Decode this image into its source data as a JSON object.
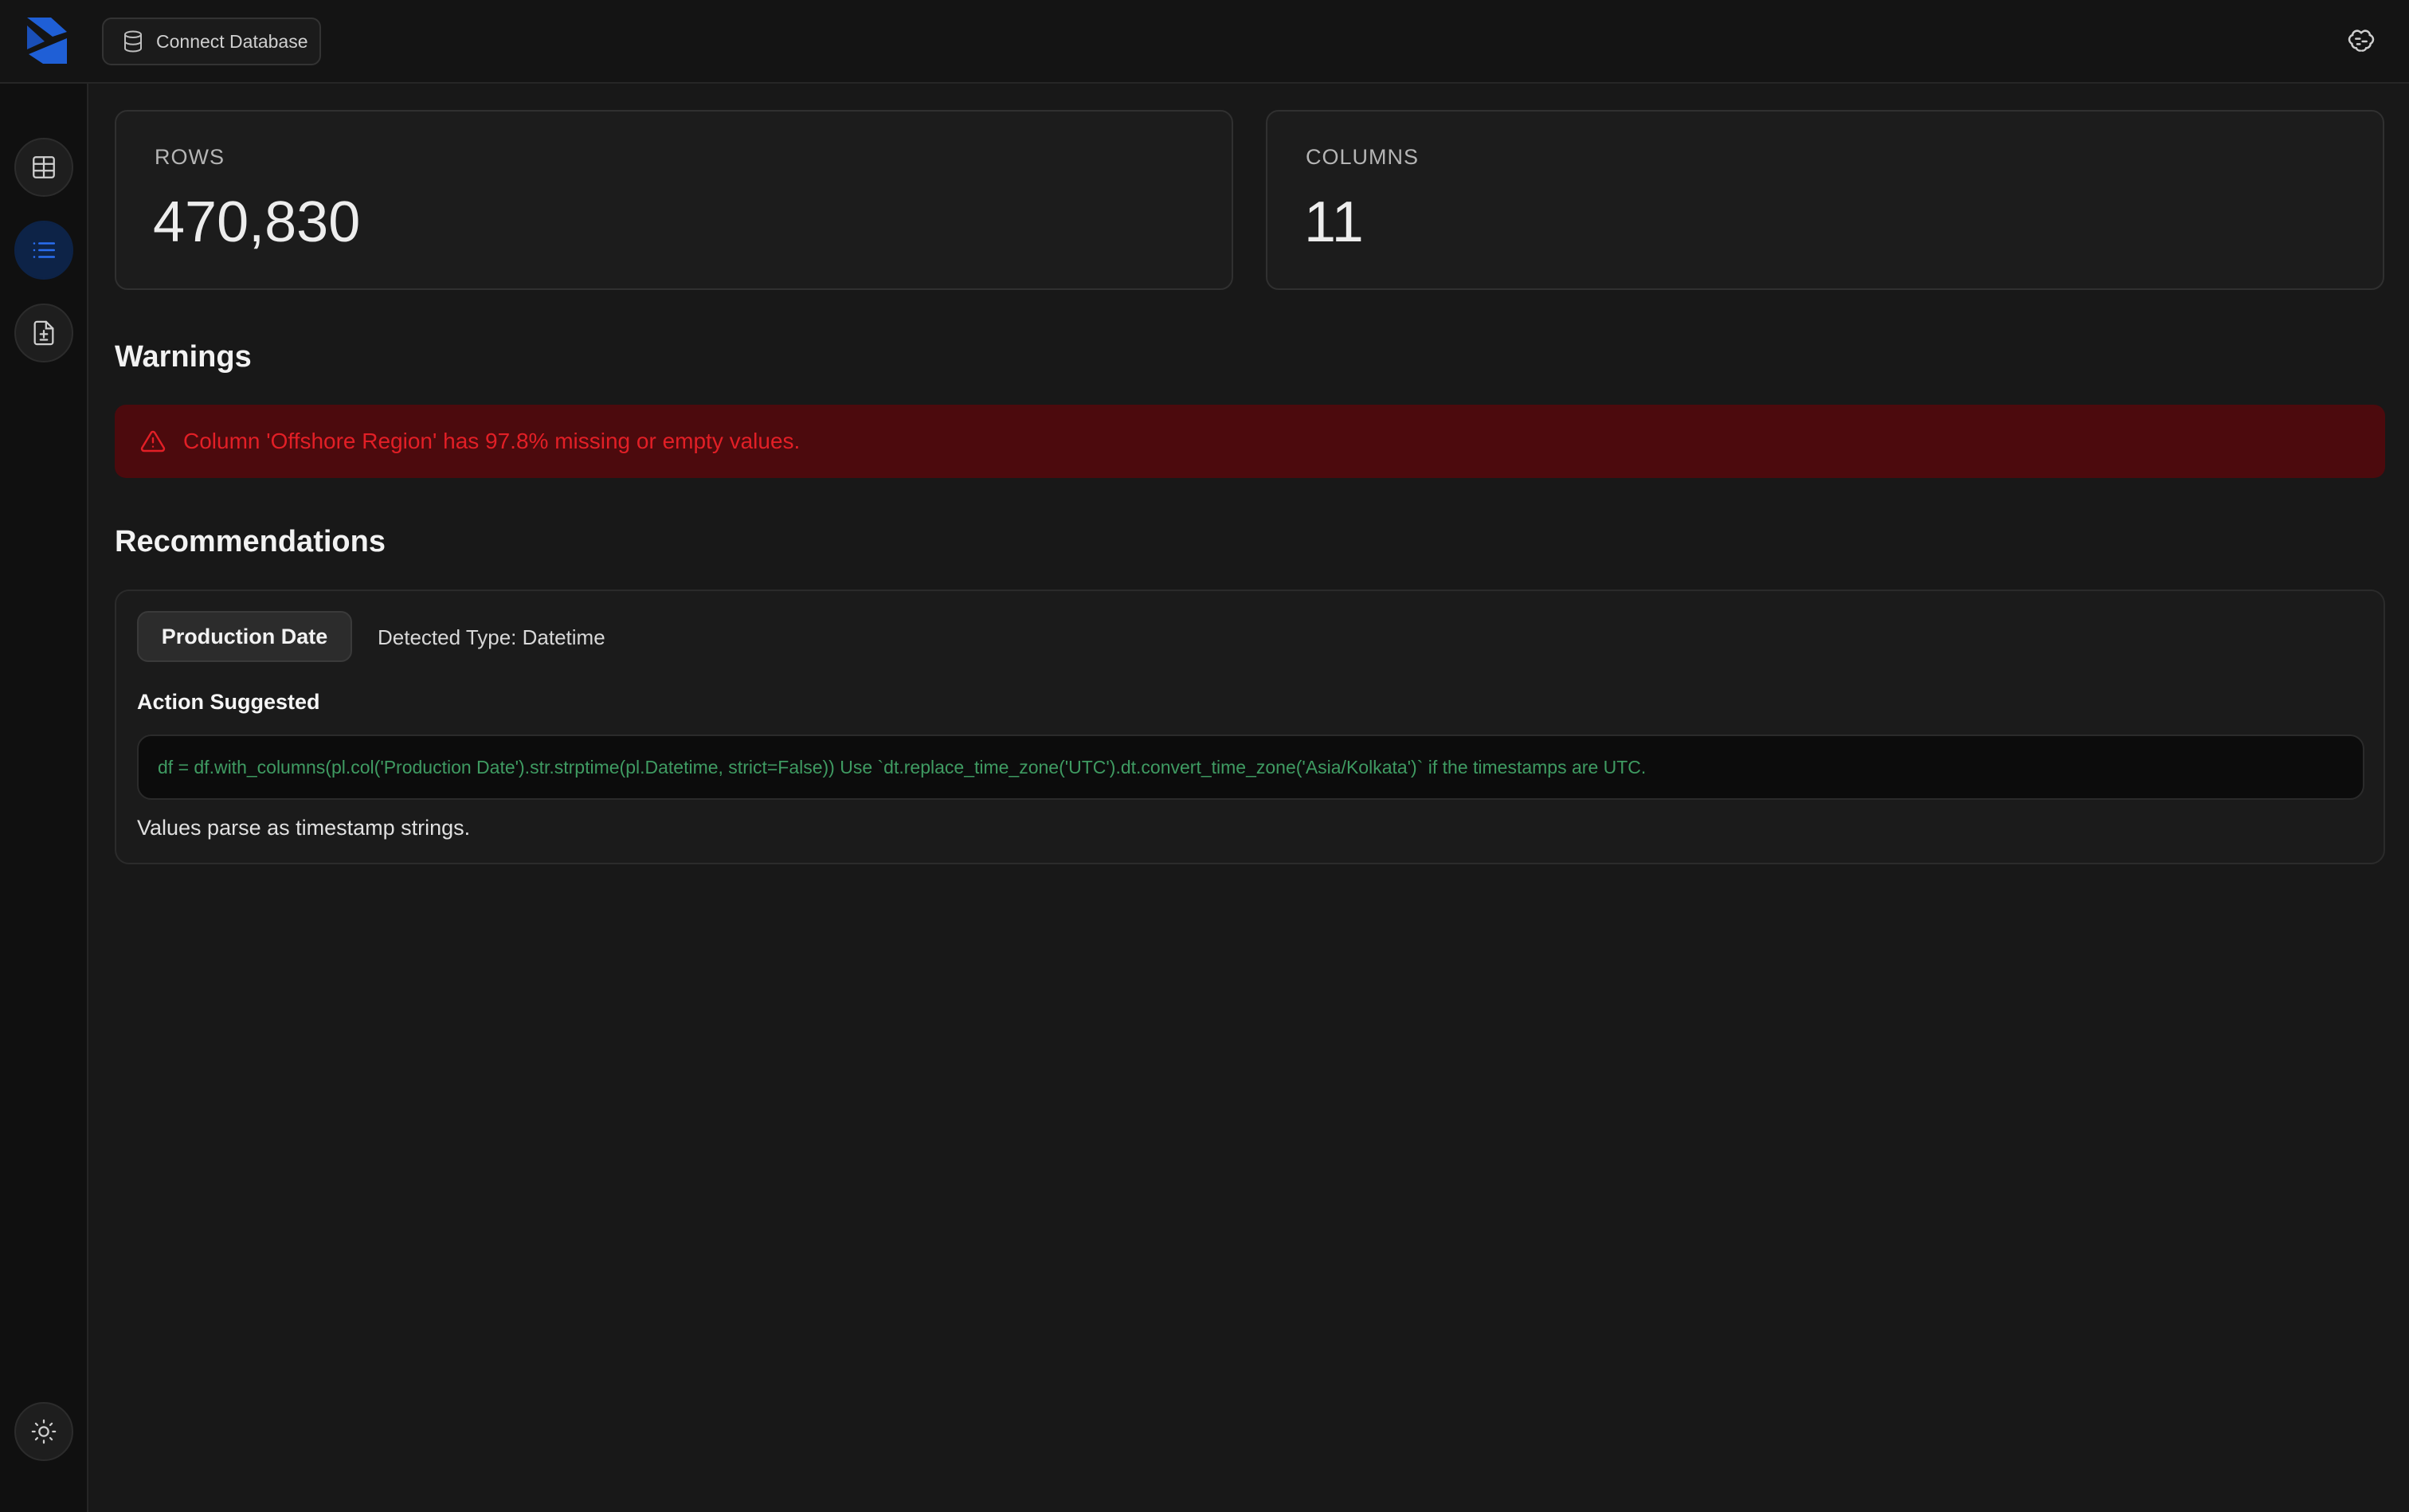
{
  "header": {
    "logo": "app-logo",
    "connect_label": "Connect Database",
    "feedback_icon": "brain-icon"
  },
  "sidebar": {
    "items": [
      {
        "icon": "table-icon",
        "active": false
      },
      {
        "icon": "list-icon",
        "active": true
      },
      {
        "icon": "file-diff-icon",
        "active": false
      }
    ],
    "theme_icon": "sun-icon"
  },
  "stats": {
    "rows_label": "ROWS",
    "rows_value": "470,830",
    "columns_label": "COLUMNS",
    "columns_value": "11"
  },
  "warnings": {
    "title": "Warnings",
    "items": [
      {
        "text": "Column 'Offshore Region' has 97.8% missing or empty values."
      }
    ]
  },
  "recommendations": {
    "title": "Recommendations",
    "items": [
      {
        "column": "Production Date",
        "detected_type": "Detected Type: Datetime",
        "action_label": "Action Suggested",
        "code": "df = df.with_columns(pl.col('Production Date').str.strptime(pl.Datetime, strict=False)) Use `dt.replace_time_zone('UTC').dt.convert_time_zone('Asia/Kolkata')` if the timestamps are UTC.",
        "description": "Values parse as timestamp strings."
      }
    ]
  },
  "colors": {
    "accent": "#1f5fd6",
    "warning_bg": "#4c0a0d",
    "warning_text": "#e21f26",
    "code_text": "#3f9b62"
  }
}
